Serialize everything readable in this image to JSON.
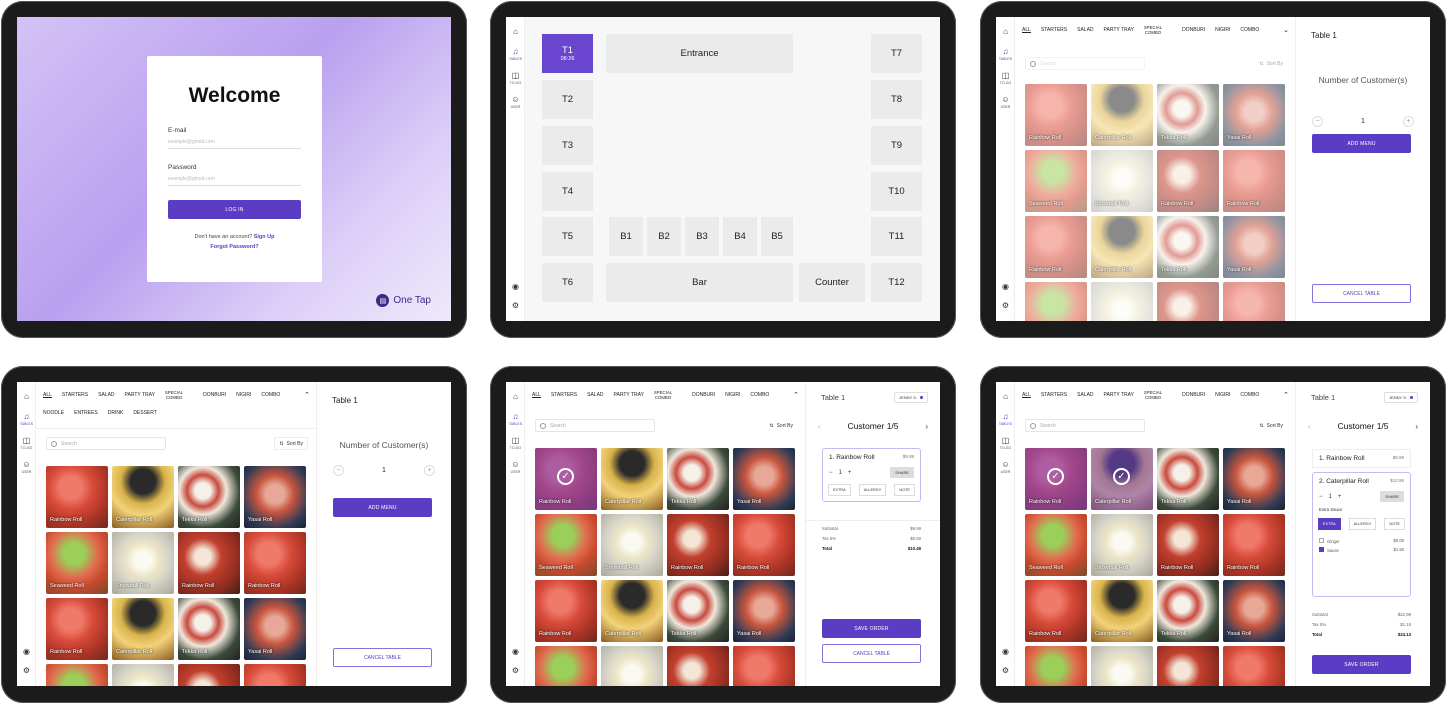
{
  "login": {
    "title": "Welcome",
    "email_label": "E-mail",
    "email_placeholder": "example@gmail.com",
    "password_label": "Password",
    "password_placeholder": "example@gmail.com",
    "login_button": "LOG IN",
    "no_account": "Don't have an account?",
    "signup": "Sign Up",
    "forgot": "Forgot Password?",
    "brand": "One Tap"
  },
  "sidebar": {
    "tables": "TABLES",
    "togo": "TO-GO",
    "user": "USER"
  },
  "floor": {
    "t1": "T1",
    "t1_time": "08:26",
    "entrance": "Entrance",
    "t2": "T2",
    "t3": "T3",
    "t4": "T4",
    "t5": "T5",
    "t6": "T6",
    "t7": "T7",
    "t8": "T8",
    "t9": "T9",
    "t10": "T10",
    "t11": "T11",
    "t12": "T12",
    "b1": "B1",
    "b2": "B2",
    "b3": "B3",
    "b4": "B4",
    "b5": "B5",
    "bar": "Bar",
    "counter": "Counter"
  },
  "categories": {
    "all": "ALL",
    "starters": "STARTERS",
    "salad": "SALAD",
    "party": "PARTY TRAY",
    "special": "SPECIAL",
    "combo_word": "COMBO",
    "donburi": "DONBURI",
    "nigiri": "NIGIRI",
    "combo": "COMBO",
    "noodle": "NOODLE",
    "entrees": "ENTREES",
    "drink": "DRINK",
    "dessert": "DESSERT"
  },
  "search_placeholder": "Search",
  "sort_by": "Sort By",
  "items": [
    "Rainbow Roll",
    "Caterpillar Roll",
    "Tekka Roll",
    "Yasai Roll",
    "Seaweed Roll",
    "Snowball Roll",
    "Rainbow Roll",
    "Rainbow Roll",
    "Rainbow Roll",
    "Caterpillar Roll",
    "Tekka Roll",
    "Yasai Roll"
  ],
  "panel": {
    "table": "Table 1",
    "customers": "Number of Customer(s)",
    "count": "1",
    "add_menu": "ADD MENU",
    "cancel": "CANCEL TABLE",
    "save": "SAVE ORDER",
    "server": "JENNY S.",
    "customer": "Customer 1/5"
  },
  "order5": {
    "item": "1. Rainbow Roll",
    "price": "$9.99",
    "qty": "1",
    "share": "SHARE",
    "extra": "EXTRA",
    "allergy": "ALLERGY",
    "note": "NOTE",
    "subtotal_l": "Subtotal",
    "subtotal": "$9.99",
    "tax_l": "Tax 5%",
    "tax": "$0.50",
    "total_l": "Total",
    "total": "$10.49"
  },
  "order6": {
    "item1": "1. Rainbow Roll",
    "price1": "$9.99",
    "item2": "2. Caterpillar Roll",
    "price2": "$12.99",
    "qty": "1",
    "share": "SHARE",
    "extra_line": "Extra  Sauce",
    "extra": "EXTRA",
    "allergy": "ALLERGY",
    "note": "NOTE",
    "ginger": "Ginger",
    "ginger_p": "$0.00",
    "sauce": "Sauce",
    "sauce_p": "$1.50",
    "subtotal_l": "Subtotal",
    "subtotal": "$22.98",
    "tax_l": "Tax 5%",
    "tax": "$1.15",
    "total_l": "Total",
    "total": "$24.13"
  }
}
